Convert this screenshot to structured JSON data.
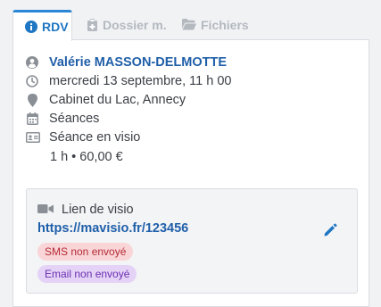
{
  "tabs": [
    {
      "label": "RDV",
      "icon": "info-circle-icon",
      "active": true
    },
    {
      "label": "Dossier m.",
      "icon": "clipboard-icon",
      "active": false
    },
    {
      "label": "Fichiers",
      "icon": "folder-icon",
      "active": false
    }
  ],
  "appointment": {
    "patient_name": "Valérie MASSON-DELMOTTE",
    "datetime": "mercredi 13 septembre, 11 h 00",
    "location": "Cabinet du Lac, Annecy",
    "category": "Séances",
    "service": "Séance en visio",
    "duration_price": "1 h • 60,00 €"
  },
  "visio": {
    "label": "Lien de visio",
    "link": "https://mavisio.fr/123456",
    "sms_status": "SMS non envoyé",
    "email_status": "Email non envoyé"
  },
  "colors": {
    "accent": "#1f76c2",
    "link": "#1f5fa9",
    "sms_badge_bg": "#f9d5d7",
    "sms_badge_text": "#b52b36",
    "email_badge_bg": "#e5d3f7",
    "email_badge_text": "#6a2fb0"
  }
}
